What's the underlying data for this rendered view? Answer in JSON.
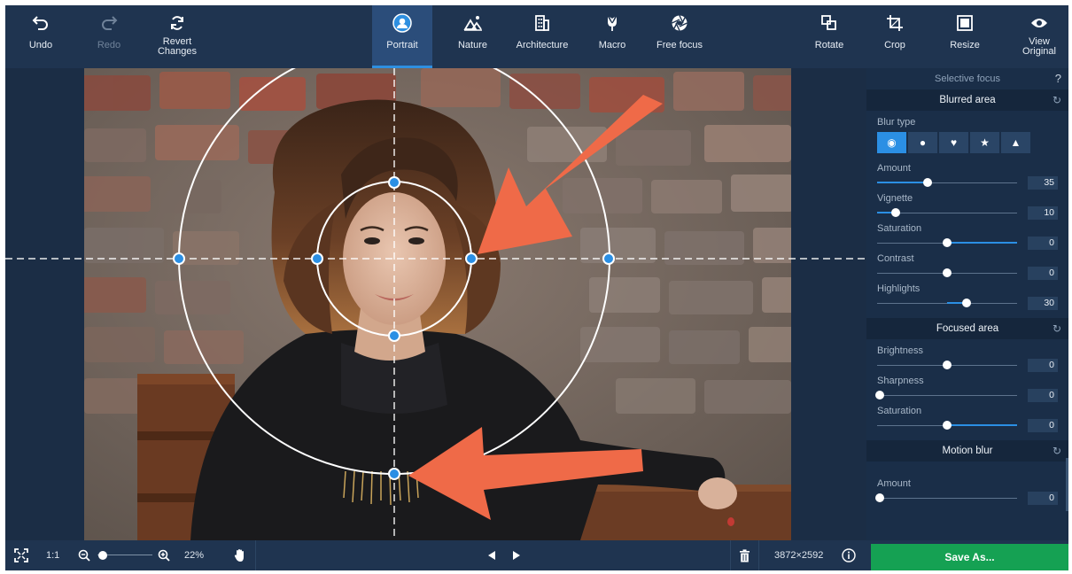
{
  "toolbar": {
    "undo": "Undo",
    "redo": "Redo",
    "revert_line1": "Revert",
    "revert_line2": "Changes",
    "modes": [
      "Portrait",
      "Nature",
      "Architecture",
      "Macro",
      "Free focus"
    ],
    "active_mode": "Portrait",
    "rotate": "Rotate",
    "crop": "Crop",
    "resize": "Resize",
    "view_line1": "View",
    "view_line2": "Original"
  },
  "panel": {
    "title": "Selective focus",
    "help": "?",
    "blurred_area": {
      "title": "Blurred area",
      "blur_type_label": "Blur type",
      "blur_types": [
        "circle-blur-icon",
        "dots-blur-icon",
        "heart-blur-icon",
        "star-blur-icon",
        "triangle-blur-icon"
      ],
      "active_blur_type": 0,
      "sliders": [
        {
          "label": "Amount",
          "value": "35",
          "pos": 0.36,
          "fill": true
        },
        {
          "label": "Vignette",
          "value": "10",
          "pos": 0.13,
          "fill": true
        },
        {
          "label": "Saturation",
          "value": "0",
          "pos": 0.5,
          "fill": false,
          "fill_right": true
        },
        {
          "label": "Contrast",
          "value": "0",
          "pos": 0.5,
          "fill": false
        },
        {
          "label": "Highlights",
          "value": "30",
          "pos": 0.64,
          "fill_from_center": true
        }
      ]
    },
    "focused_area": {
      "title": "Focused area",
      "sliders": [
        {
          "label": "Brightness",
          "value": "0",
          "pos": 0.5
        },
        {
          "label": "Sharpness",
          "value": "0",
          "pos": 0.02
        },
        {
          "label": "Saturation",
          "value": "0",
          "pos": 0.5,
          "fill_right": true
        }
      ]
    },
    "motion_blur": {
      "title": "Motion blur",
      "sliders": [
        {
          "label": "Amount",
          "value": "0",
          "pos": 0.02
        }
      ]
    }
  },
  "bottombar": {
    "actual_size": "1:1",
    "zoom": "22%",
    "zoom_pos": 0.1,
    "dimensions": "3872×2592",
    "save": "Save As..."
  },
  "colors": {
    "accent": "#2b8fe4",
    "save_green": "#15a153",
    "arrow": "#ef6a48",
    "handle": "#2b8fe4"
  }
}
